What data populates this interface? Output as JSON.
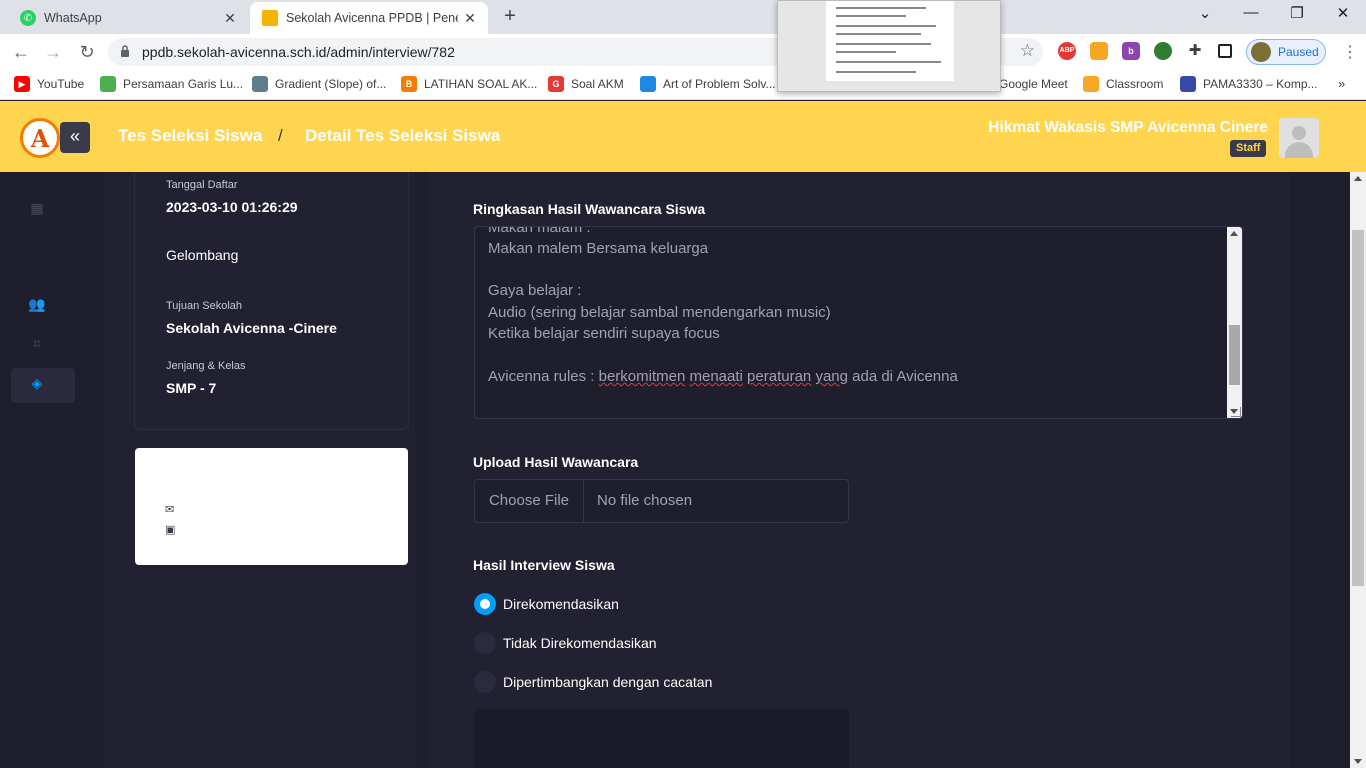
{
  "browser": {
    "tabs": [
      {
        "title": "WhatsApp",
        "icon": "whatsapp-icon",
        "color": "#25d366"
      },
      {
        "title": "Sekolah Avicenna PPDB | Penerim",
        "icon": "folder-icon",
        "color": "#f4b400"
      }
    ],
    "url": "ppdb.sekolah-avicenna.sch.id/admin/interview/782",
    "profile_label": "Paused",
    "extensions": [
      {
        "name": "abp-icon",
        "label": "ABP",
        "color": "#e53935"
      },
      {
        "name": "grid-extension-icon",
        "label": "",
        "color": "#f5a623"
      },
      {
        "name": "b-extension-icon",
        "label": "b",
        "color": "#8e44ad"
      },
      {
        "name": "alien-extension-icon",
        "label": "",
        "color": "#2e7d32"
      },
      {
        "name": "puzzle-icon",
        "label": "",
        "color": "#5f6368"
      },
      {
        "name": "sidepanel-icon",
        "label": "",
        "color": "#202124"
      }
    ]
  },
  "bookmarks": [
    {
      "label": "YouTube",
      "icon": "youtube-icon",
      "color": "#ff0000"
    },
    {
      "label": "Persamaan Garis Lu...",
      "icon": "bookmark-icon",
      "color": "#4caf50"
    },
    {
      "label": "Gradient (Slope) of...",
      "icon": "bookmark-icon",
      "color": "#607d8b"
    },
    {
      "label": "LATIHAN SOAL AK...",
      "icon": "blogger-icon",
      "color": "#f57c00"
    },
    {
      "label": "Soal AKM",
      "icon": "bookmark-icon",
      "color": "#e53935"
    },
    {
      "label": "Art of Problem Solv...",
      "icon": "bookmark-icon",
      "color": "#1e88e5"
    },
    {
      "label": "Google Meet",
      "icon": "meet-icon",
      "color": "#00897b"
    },
    {
      "label": "Classroom",
      "icon": "classroom-icon",
      "color": "#f9a825"
    },
    {
      "label": "PAMA3330 – Komp...",
      "icon": "bookmark-icon",
      "color": "#3949ab"
    }
  ],
  "header": {
    "logo_letter": "A",
    "breadcrumb": [
      "Tes Seleksi Siswa",
      "Detail Tes Seleksi Siswa"
    ],
    "breadcrumb_sep": "/",
    "user_name": "Hikmat Wakasis SMP Avicenna Cinere",
    "user_role": "Staff",
    "accent": "#ffd54f"
  },
  "student_info": {
    "tanggal_daftar_label": "Tanggal Daftar",
    "tanggal_daftar": "2023-03-10 01:26:29",
    "gelombang_label": "Gelombang",
    "tujuan_label": "Tujuan Sekolah",
    "tujuan": "Sekolah Avicenna -Cinere",
    "jenjang_label": "Jenjang & Kelas",
    "jenjang": "SMP - 7"
  },
  "summary": {
    "title": "Ringkasan Hasil Wawancara Siswa",
    "lines": [
      "Makan malam :",
      "Makan malem Bersama keluarga",
      "",
      "Gaya belajar :",
      "Audio (sering belajar sambal mendengarkan music)",
      "Ketika belajar sendiri supaya focus",
      "",
      "Avicenna rules : berkomitmen menaati peraturan yang ada di Avicenna"
    ]
  },
  "upload": {
    "title": "Upload Hasil Wawancara",
    "button": "Choose File",
    "status": "No file chosen"
  },
  "result": {
    "title": "Hasil Interview Siswa",
    "options": [
      {
        "label": "Direkomendasikan",
        "checked": true
      },
      {
        "label": "Tidak Direkomendasikan",
        "checked": false
      },
      {
        "label": "Dipertimbangkan dengan cacatan",
        "checked": false
      }
    ]
  }
}
